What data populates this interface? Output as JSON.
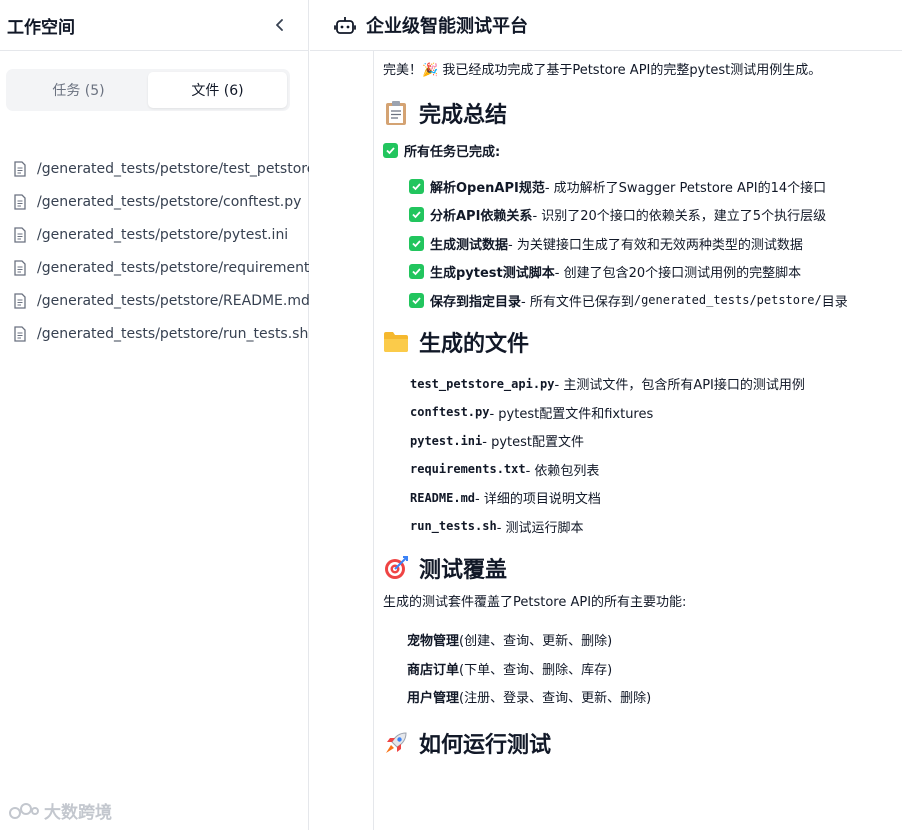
{
  "sidebar": {
    "title": "工作空间",
    "tabs": [
      {
        "label": "任务 (5)"
      },
      {
        "label": "文件 (6)"
      }
    ],
    "files": [
      "/generated_tests/petstore/test_petstore_api.py",
      "/generated_tests/petstore/conftest.py",
      "/generated_tests/petstore/pytest.ini",
      "/generated_tests/petstore/requirements.txt",
      "/generated_tests/petstore/README.md",
      "/generated_tests/petstore/run_tests.sh"
    ]
  },
  "watermark": "大数跨境",
  "main": {
    "title": "企业级智能测试平台",
    "intro": "完美！🎉 我已经成功完成了基于Petstore API的完整pytest测试用例生成。",
    "summary": {
      "heading": "完成总结",
      "all_done": "所有任务已完成:",
      "items": [
        {
          "bold": "解析OpenAPI规范",
          "rest": " - 成功解析了Swagger Petstore API的14个接口"
        },
        {
          "bold": "分析API依赖关系",
          "rest": " - 识别了20个接口的依赖关系，建立了5个执行层级"
        },
        {
          "bold": "生成测试数据",
          "rest": " - 为关键接口生成了有效和无效两种类型的测试数据"
        },
        {
          "bold": "生成pytest测试脚本",
          "rest": " - 创建了包含20个接口测试用例的完整脚本"
        },
        {
          "bold": "保存到指定目录",
          "rest": " - 所有文件已保存到 ",
          "code": "/generated_tests/petstore/",
          "tail": " 目录"
        }
      ]
    },
    "files_section": {
      "heading": "生成的文件",
      "items": [
        {
          "name": "test_petstore_api.py",
          "desc": " - 主测试文件，包含所有API接口的测试用例"
        },
        {
          "name": "conftest.py",
          "desc": " - pytest配置文件和fixtures"
        },
        {
          "name": "pytest.ini",
          "desc": " - pytest配置文件"
        },
        {
          "name": "requirements.txt",
          "desc": " - 依赖包列表"
        },
        {
          "name": "README.md",
          "desc": " - 详细的项目说明文档"
        },
        {
          "name": "run_tests.sh",
          "desc": " - 测试运行脚本"
        }
      ]
    },
    "coverage": {
      "heading": "测试覆盖",
      "intro": "生成的测试套件覆盖了Petstore API的所有主要功能:",
      "items": [
        {
          "bold": "宠物管理",
          "rest": " (创建、查询、更新、删除)"
        },
        {
          "bold": "商店订单",
          "rest": " (下单、查询、删除、库存)"
        },
        {
          "bold": "用户管理",
          "rest": " (注册、登录、查询、更新、删除)"
        }
      ]
    },
    "run": {
      "heading": "如何运行测试"
    }
  }
}
